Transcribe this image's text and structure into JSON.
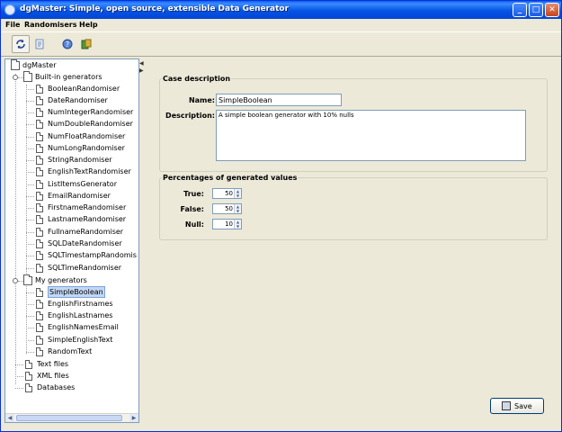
{
  "window": {
    "title": "dgMaster: Simple, open source, extensible Data Generator",
    "controls": {
      "minimize": "_",
      "maximize": "□",
      "close": "✕"
    }
  },
  "menu": [
    "File",
    "Randomisers",
    "Help"
  ],
  "toolbar": {
    "buttons": [
      {
        "name": "refresh-icon"
      },
      {
        "name": "document-icon"
      },
      {
        "name": "help-icon"
      },
      {
        "name": "export-icon"
      }
    ]
  },
  "tree": {
    "root": "dgMaster",
    "builtin_label": "Built-in generators",
    "builtin": [
      "BooleanRandomiser",
      "DateRandomiser",
      "NumIntegerRandomiser",
      "NumDoubleRandomiser",
      "NumFloatRandomiser",
      "NumLongRandomiser",
      "StringRandomiser",
      "EnglishTextRandomiser",
      "ListItemsGenerator",
      "EmailRandomiser",
      "FirstnameRandomiser",
      "LastnameRandomiser",
      "FullnameRandomiser",
      "SQLDateRandomiser",
      "SQLTimestampRandomis",
      "SQLTimeRandomiser"
    ],
    "my_label": "My generators",
    "my": [
      "SimpleBoolean",
      "EnglishFirstnames",
      "EnglishLastnames",
      "EnglishNamesEmail",
      "SimpleEnglishText",
      "RandomText"
    ],
    "selected": "SimpleBoolean",
    "other": [
      "Text files",
      "XML files",
      "Databases"
    ]
  },
  "case": {
    "legend": "Case description",
    "name_label": "Name:",
    "name_value": "SimpleBoolean",
    "desc_label": "Description:",
    "desc_value": "A simple boolean generator with 10% nulls"
  },
  "percentages": {
    "legend": "Percentages of generated values",
    "true_label": "True:",
    "true_value": "50",
    "false_label": "False:",
    "false_value": "50",
    "null_label": "Null:",
    "null_value": "10"
  },
  "save_label": "Save"
}
